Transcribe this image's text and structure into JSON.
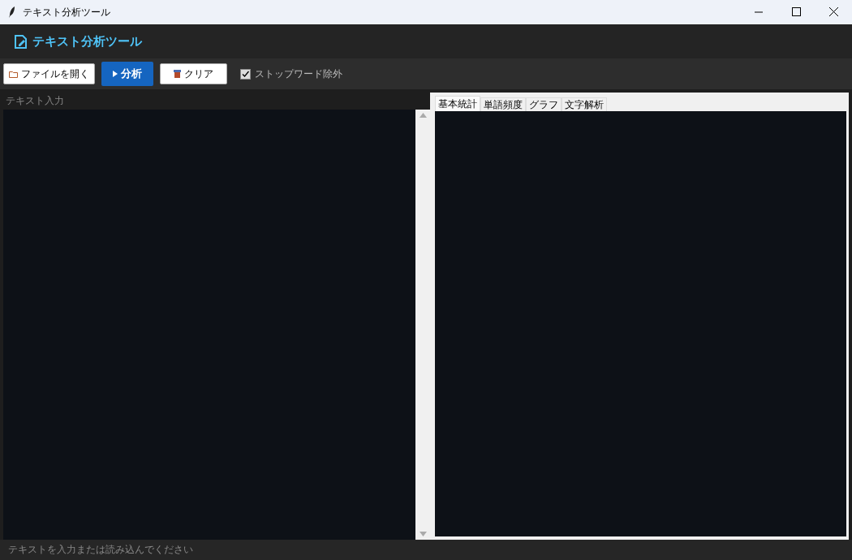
{
  "window": {
    "title": "テキスト分析ツール"
  },
  "header": {
    "title": "テキスト分析ツール"
  },
  "toolbar": {
    "buttons": [
      {
        "kind": "open",
        "label": "ファイルを開く"
      },
      {
        "kind": "analyze",
        "label": "分析"
      },
      {
        "kind": "clear",
        "label": "クリア"
      }
    ],
    "stopword_checkbox": {
      "label": "ストップワード除外",
      "checked": true
    }
  },
  "input_panel": {
    "label": "テキスト入力"
  },
  "result_tabs": [
    {
      "label": "基本統計",
      "selected": true
    },
    {
      "label": "単語頻度",
      "selected": false
    },
    {
      "label": "グラフ",
      "selected": false
    },
    {
      "label": "文字解析",
      "selected": false
    }
  ],
  "status_bar": {
    "text": "テキストを入力または読み込んでください"
  }
}
